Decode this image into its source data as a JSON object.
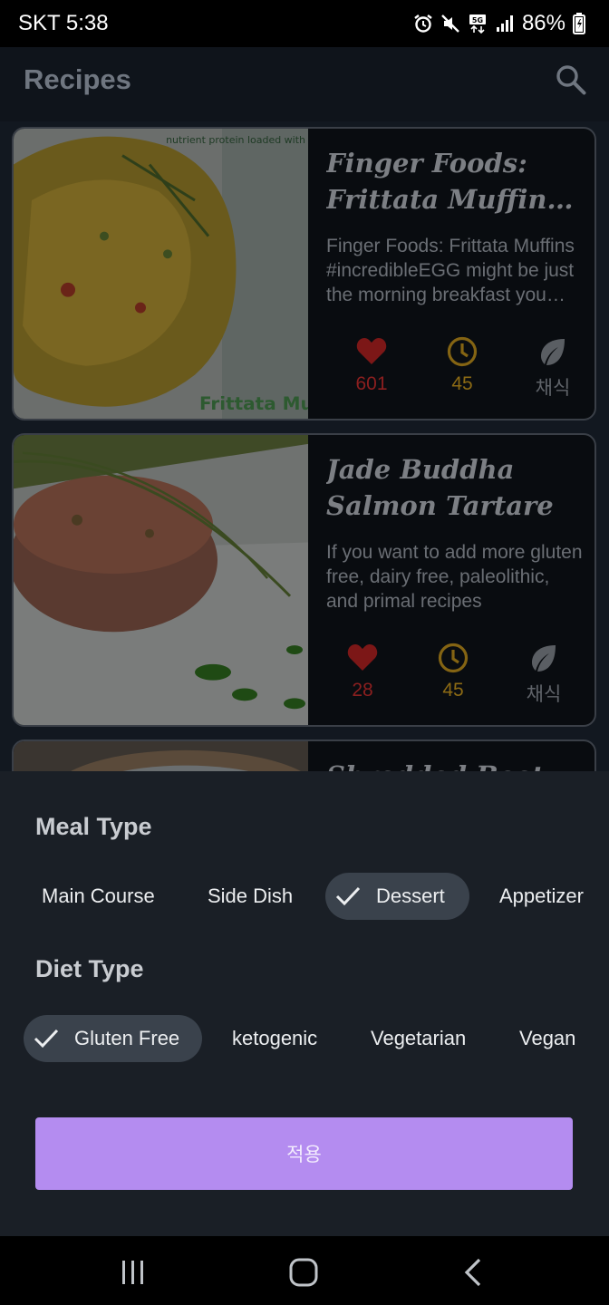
{
  "status_bar": {
    "carrier_time": "SKT 5:38",
    "battery": "86%",
    "icons": [
      "alarm-icon",
      "mute-icon",
      "5g-icon",
      "signal-icon",
      "battery-icon"
    ]
  },
  "app_bar": {
    "title": "Recipes",
    "search_icon": "search-icon"
  },
  "recipes": [
    {
      "title": "Finger Foods: Frittata Muffins #incredibleEGG",
      "description": "Finger Foods: Frittata Muffins #incredibleEGG might be just the morning breakfast you need",
      "likes": "601",
      "minutes": "45",
      "tag": "채식",
      "image_text": "Frittata Mu",
      "image_caption": "nutrient protein loaded with"
    },
    {
      "title": "Jade Buddha Salmon Tartare",
      "description": "If you want to add more gluten free, dairy free, paleolithic, and primal recipes",
      "likes": "28",
      "minutes": "45",
      "tag": "채식"
    },
    {
      "title": "Shredded Beet"
    }
  ],
  "filter_sheet": {
    "meal_type_title": "Meal Type",
    "meal_types": [
      {
        "label": "Main Course",
        "selected": false
      },
      {
        "label": "Side Dish",
        "selected": false
      },
      {
        "label": "Dessert",
        "selected": true
      },
      {
        "label": "Appetizer",
        "selected": false
      }
    ],
    "diet_type_title": "Diet Type",
    "diet_types": [
      {
        "label": "Gluten Free",
        "selected": true
      },
      {
        "label": "ketogenic",
        "selected": false
      },
      {
        "label": "Vegetarian",
        "selected": false
      },
      {
        "label": "Vegan",
        "selected": false
      }
    ],
    "apply_label": "적용"
  },
  "nav_bar": {
    "recent_icon": "recent-apps-icon",
    "home_icon": "home-icon",
    "back_icon": "back-icon"
  },
  "colors": {
    "accent": "#b48cf0",
    "like": "#b52a2a",
    "time": "#b8901c",
    "sheet_bg": "#1a1f26",
    "chip_selected": "#3a424c"
  }
}
